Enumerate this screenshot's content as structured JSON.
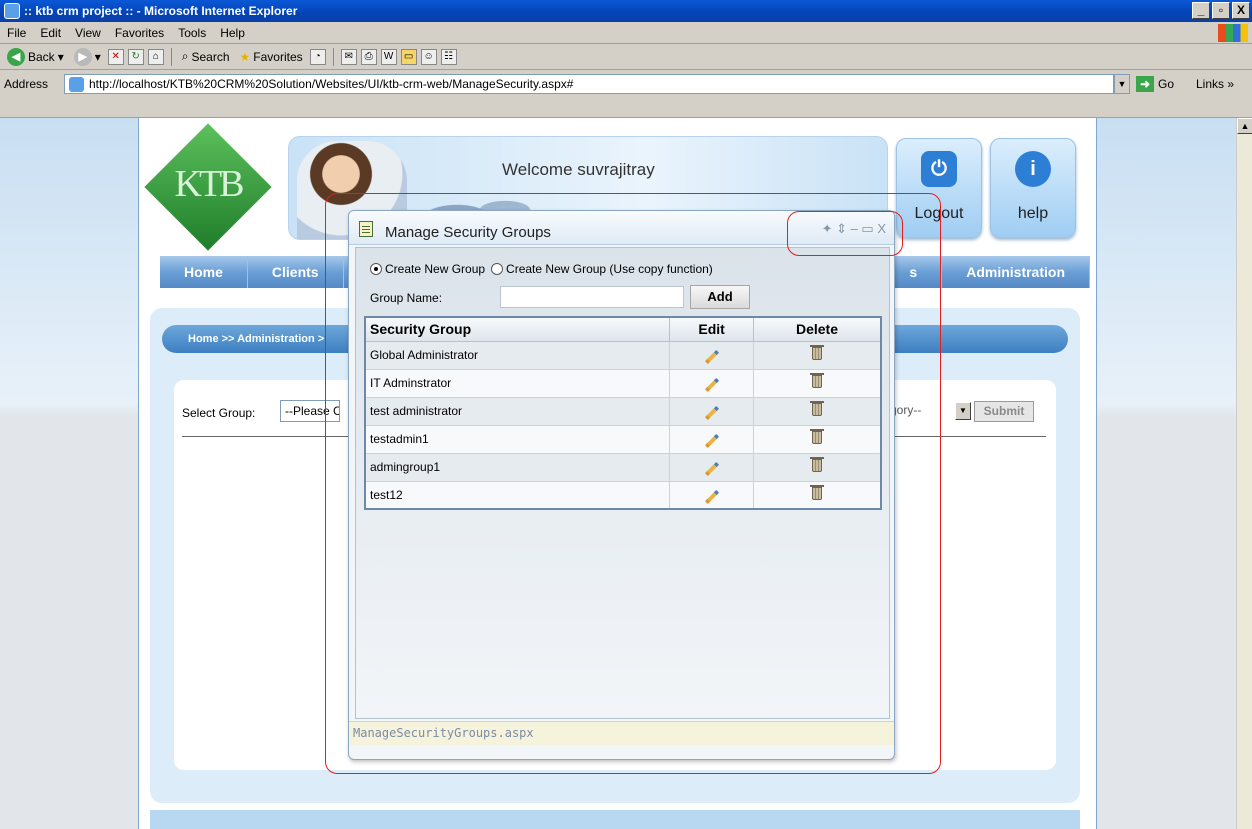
{
  "window": {
    "title": ":: ktb crm project :: - Microsoft Internet Explorer",
    "controls": [
      "_",
      "▫",
      "X"
    ]
  },
  "menu": [
    "File",
    "Edit",
    "View",
    "Favorites",
    "Tools",
    "Help"
  ],
  "toolbar": {
    "back": "Back",
    "search": "Search",
    "favorites": "Favorites"
  },
  "address": {
    "label": "Address",
    "url": "http://localhost/KTB%20CRM%20Solution/Websites/UI/ktb-crm-web/ManageSecurity.aspx#",
    "go": "Go",
    "links": "Links"
  },
  "header": {
    "logo_text": "KTB",
    "welcome": "Welcome suvrajitray",
    "logout": "Logout",
    "help": "help"
  },
  "nav": {
    "home": "Home",
    "clients": "Clients",
    "partial": "s",
    "administration": "Administration"
  },
  "breadcrumb": "Home >> Administration >",
  "form": {
    "select_label": "Select Group:",
    "select_value": "--Please Cl",
    "category_value": "gory--",
    "submit": "Submit"
  },
  "modal": {
    "title": "Manage Security Groups",
    "controls": "✦ ⇕ – ▭ X",
    "radio_new": "Create New Group",
    "radio_copy": "Create New Group (Use copy function)",
    "group_name_label": "Group Name:",
    "group_name_value": "",
    "add": "Add",
    "columns": [
      "Security Group",
      "Edit",
      "Delete"
    ],
    "rows": [
      "Global Administrator",
      "IT Adminstrator",
      "test administrator",
      "testadmin1",
      "admingroup1",
      "test12"
    ],
    "footer": "ManageSecurityGroups.aspx"
  }
}
